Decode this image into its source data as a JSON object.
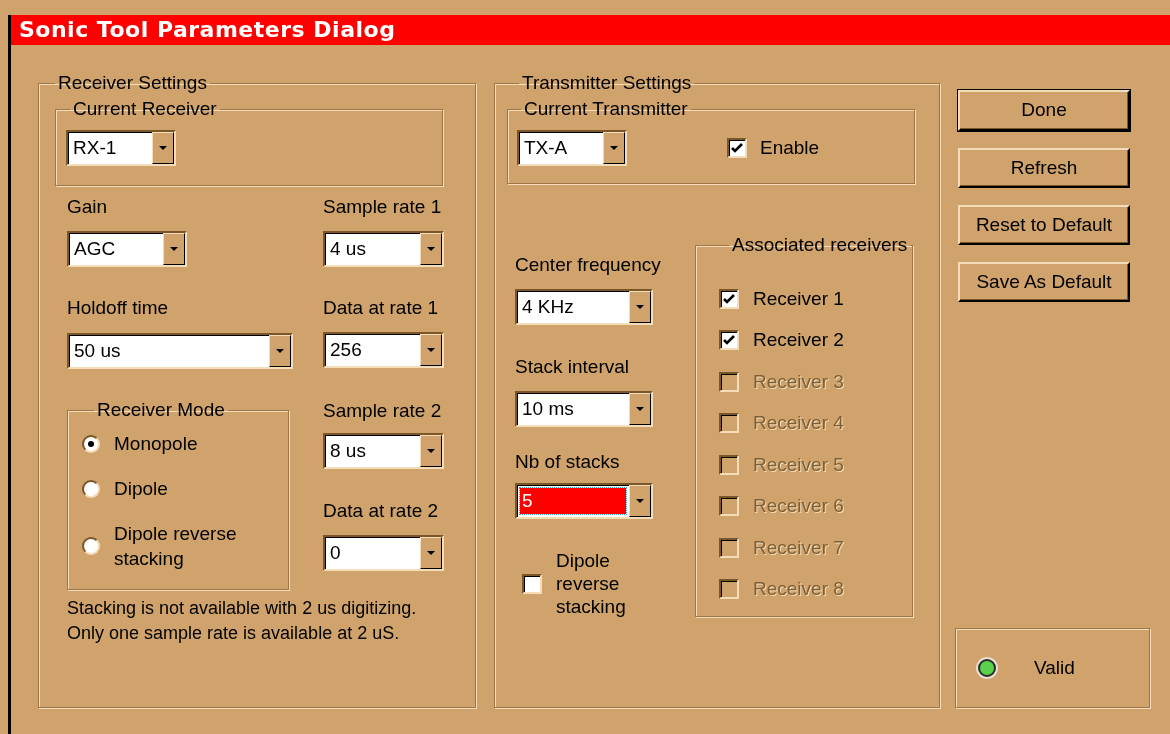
{
  "window": {
    "title": "Sonic Tool Parameters Dialog"
  },
  "receiver_settings": {
    "title": "Receiver Settings",
    "current_receiver": {
      "title": "Current Receiver",
      "value": "RX-1"
    },
    "gain": {
      "label": "Gain",
      "value": "AGC"
    },
    "holdoff_time": {
      "label": "Holdoff time",
      "value": "50 us"
    },
    "receiver_mode": {
      "title": "Receiver Mode",
      "options": [
        {
          "label": "Monopole",
          "selected": true
        },
        {
          "label": "Dipole",
          "selected": false
        },
        {
          "label": "Dipole reverse stacking",
          "selected": false
        }
      ]
    },
    "sample_rate_1": {
      "label": "Sample rate 1",
      "value": "4 us"
    },
    "data_at_rate_1": {
      "label": "Data at rate 1",
      "value": "256"
    },
    "sample_rate_2": {
      "label": "Sample rate 2",
      "value": "8 us"
    },
    "data_at_rate_2": {
      "label": "Data at rate 2",
      "value": "0"
    },
    "note": "Stacking is not available with 2 us digitizing.\nOnly one sample rate is available at 2 uS."
  },
  "transmitter_settings": {
    "title": "Transmitter Settings",
    "current_transmitter": {
      "title": "Current Transmitter",
      "value": "TX-A",
      "enable": {
        "label": "Enable",
        "checked": true
      }
    },
    "center_frequency": {
      "label": "Center frequency",
      "value": "4 KHz"
    },
    "stack_interval": {
      "label": "Stack interval",
      "value": "10 ms"
    },
    "nb_of_stacks": {
      "label": "Nb of stacks",
      "value": "5",
      "focused": true
    },
    "dipole_reverse_stacking": {
      "label": "Dipole reverse stacking",
      "checked": false
    },
    "associated_receivers": {
      "title": "Associated receivers",
      "items": [
        {
          "label": "Receiver 1",
          "checked": true,
          "disabled": false
        },
        {
          "label": "Receiver 2",
          "checked": true,
          "disabled": false
        },
        {
          "label": "Receiver 3",
          "checked": false,
          "disabled": true
        },
        {
          "label": "Receiver 4",
          "checked": false,
          "disabled": true
        },
        {
          "label": "Receiver 5",
          "checked": false,
          "disabled": true
        },
        {
          "label": "Receiver 6",
          "checked": false,
          "disabled": true
        },
        {
          "label": "Receiver 7",
          "checked": false,
          "disabled": true
        },
        {
          "label": "Receiver 8",
          "checked": false,
          "disabled": true
        }
      ]
    }
  },
  "buttons": [
    {
      "label": "Done",
      "default": true
    },
    {
      "label": "Refresh",
      "default": false
    },
    {
      "label": "Reset to Default",
      "default": false
    },
    {
      "label": "Save As Default",
      "default": false
    }
  ],
  "status": {
    "label": "Valid",
    "valid": true
  }
}
